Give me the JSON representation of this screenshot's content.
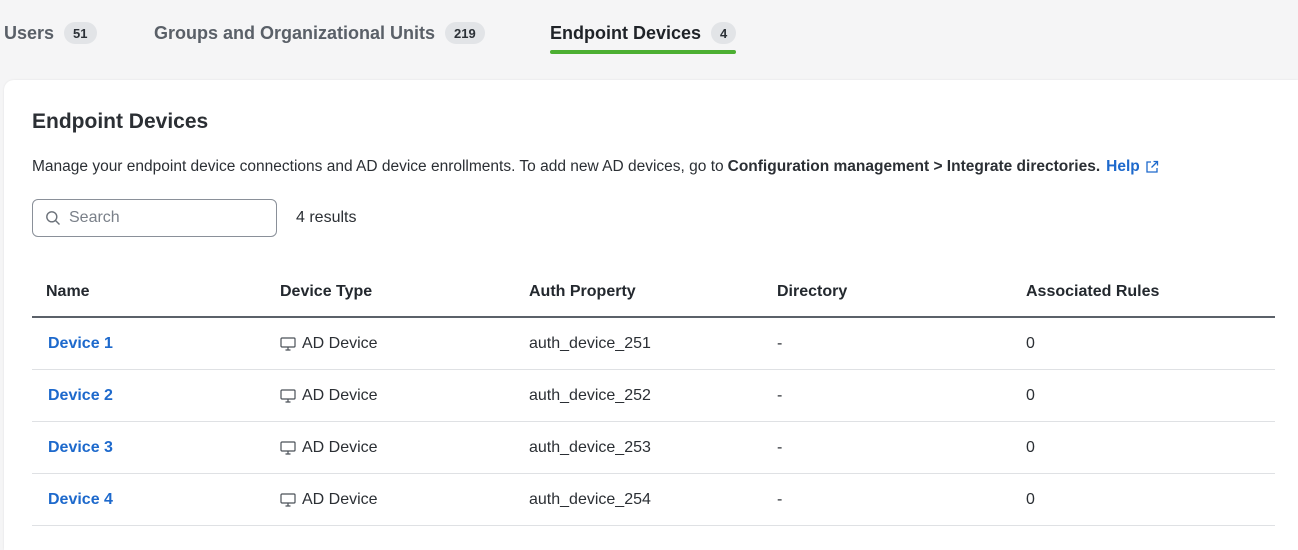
{
  "tabs": [
    {
      "label": "Users",
      "count": "51"
    },
    {
      "label": "Groups and Organizational Units",
      "count": "219"
    },
    {
      "label": "Endpoint Devices",
      "count": "4"
    }
  ],
  "panel": {
    "title": "Endpoint Devices",
    "description_text": "Manage your endpoint device connections and AD device enrollments. To add new AD devices, go to",
    "description_strong": "Configuration management > Integrate directories.",
    "help_label": "Help"
  },
  "search": {
    "placeholder": "Search",
    "value": ""
  },
  "results_text": "4 results",
  "table": {
    "headers": [
      "Name",
      "Device Type",
      "Auth Property",
      "Directory",
      "Associated Rules"
    ],
    "rows": [
      {
        "name": "Device 1",
        "type": "AD Device",
        "auth": "auth_device_251",
        "directory": "-",
        "rules": "0"
      },
      {
        "name": "Device 2",
        "type": "AD Device",
        "auth": "auth_device_252",
        "directory": "-",
        "rules": "0"
      },
      {
        "name": "Device 3",
        "type": "AD Device",
        "auth": "auth_device_253",
        "directory": "-",
        "rules": "0"
      },
      {
        "name": "Device 4",
        "type": "AD Device",
        "auth": "auth_device_254",
        "directory": "-",
        "rules": "0"
      }
    ]
  },
  "colors": {
    "accent_link": "#1d69cc",
    "active_tab_underline": "#4caf32"
  },
  "icons": {
    "search": "search-icon",
    "help": "external-link-icon",
    "device": "monitor-icon"
  }
}
